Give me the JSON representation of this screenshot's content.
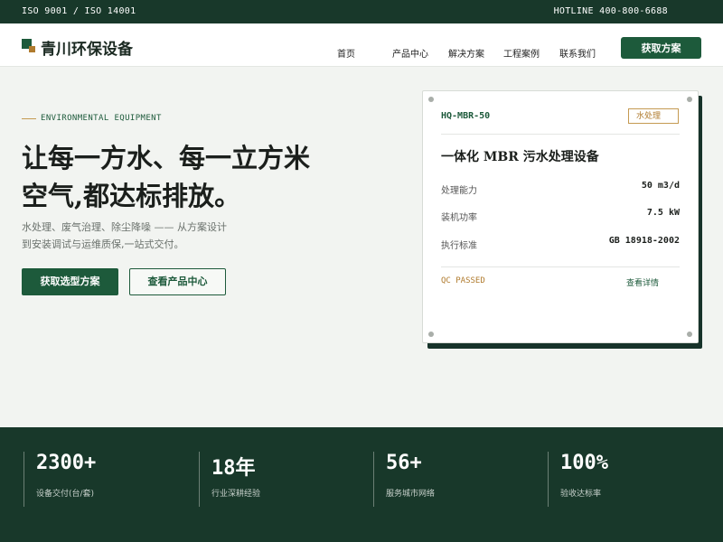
{
  "topbar": {
    "certifications": "ISO 9001 / ISO 14001",
    "hotline": "HOTLINE 400-800-6688"
  },
  "header": {
    "brand": "青川环保设备",
    "nav": [
      "首页",
      "产品中心",
      "解决方案",
      "工程案例",
      "联系我们"
    ],
    "cta": "获取方案"
  },
  "hero": {
    "eyebrow": "ENVIRONMENTAL EQUIPMENT",
    "headline_line1": "让每一方水、每一立方米",
    "headline_line2": "空气,都达标排放。",
    "desc_line1": "水处理、废气治理、除尘降噪 —— 从方案设计",
    "desc_line2": "到安装调试与运维质保,一站式交付。",
    "primary_button": "获取选型方案",
    "secondary_button": "查看产品中心"
  },
  "product_card": {
    "model": "HQ-MBR-50",
    "tag": "水处理",
    "title": "一体化 MBR 污水处理设备",
    "specs": [
      {
        "label": "处理能力",
        "value": "50 m3/d"
      },
      {
        "label": "装机功率",
        "value": "7.5 kW"
      },
      {
        "label": "执行标准",
        "value": "GB 18918-2002"
      }
    ],
    "qc": "QC PASSED",
    "detail_link": "查看详情"
  },
  "stats": [
    {
      "value": "2300+",
      "label": "设备交付(台/套)"
    },
    {
      "value": "18年",
      "label": "行业深耕经验"
    },
    {
      "value": "56+",
      "label": "服务城市网络"
    },
    {
      "value": "100%",
      "label": "验收达标率"
    }
  ],
  "colors": {
    "primary_green": "#1d5a3b",
    "dark_green": "#18382a",
    "accent_gold": "#b07b2e",
    "page_bg": "#f2f4f1"
  }
}
